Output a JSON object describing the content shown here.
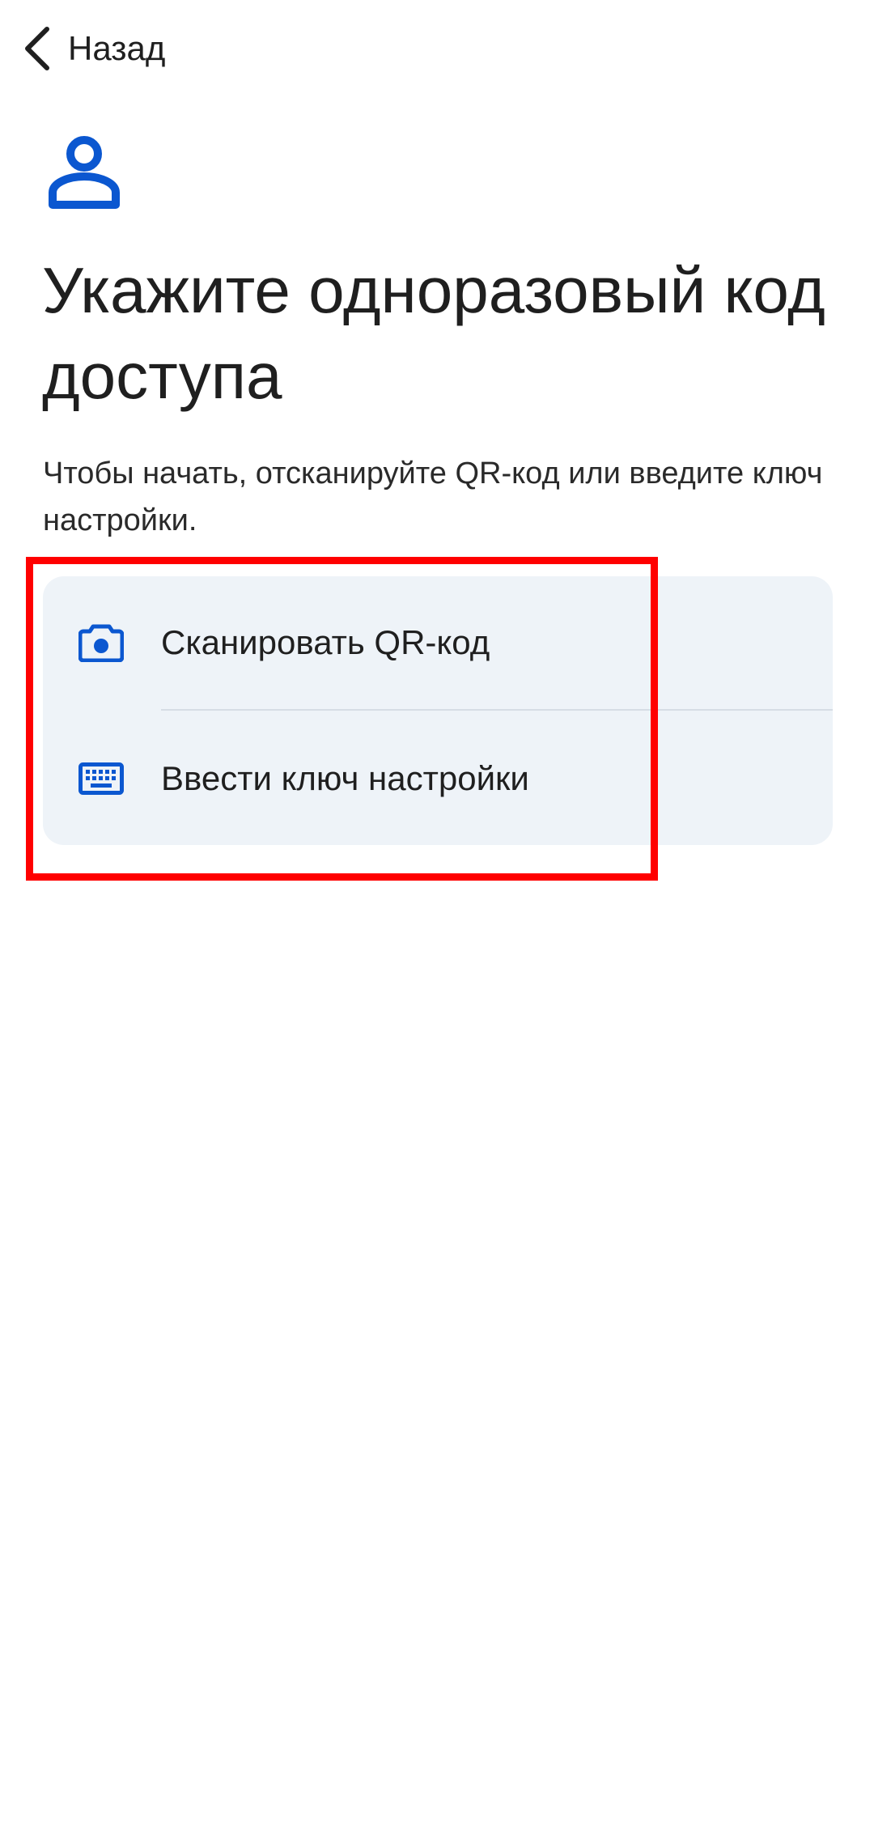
{
  "header": {
    "back_label": "Назад",
    "back_icon": "chevron-left-icon"
  },
  "hero": {
    "icon": "person-icon",
    "title": "Укажите одноразовый код доступа",
    "subtitle": "Чтобы начать, отсканируйте QR-код или введите ключ настройки."
  },
  "options": [
    {
      "icon": "camera-icon",
      "label": "Сканировать QR-код"
    },
    {
      "icon": "keyboard-icon",
      "label": "Ввести ключ настройки"
    }
  ],
  "colors": {
    "accent": "#0b57d0",
    "card_background": "#eef3f8",
    "highlight": "#ff0000",
    "text": "#1f1f1f"
  }
}
